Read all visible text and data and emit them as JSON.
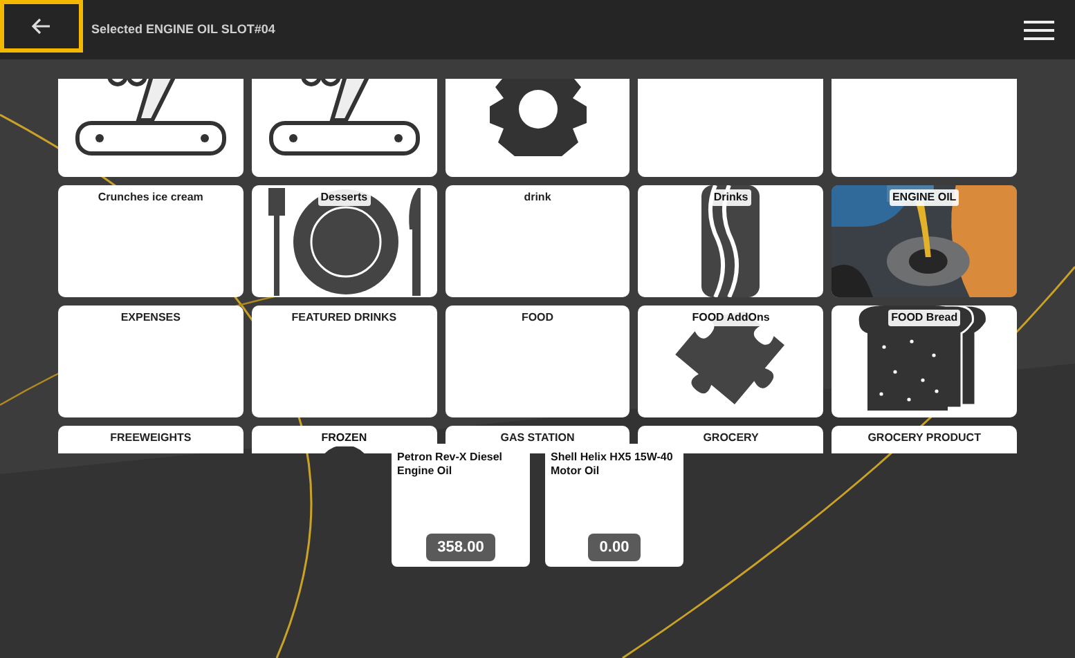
{
  "header": {
    "title": "Selected ENGINE OIL SLOT#04"
  },
  "categories": [
    {
      "kind": "tools"
    },
    {
      "kind": "tools"
    },
    {
      "kind": "gear"
    },
    {
      "kind": "plain"
    },
    {
      "kind": "plain"
    },
    {
      "label": "Crunches ice cream",
      "kind": "plain"
    },
    {
      "label": "Desserts",
      "kind": "plate"
    },
    {
      "label": "drink",
      "kind": "plain"
    },
    {
      "label": "Drinks",
      "kind": "bottle"
    },
    {
      "label": "ENGINE OIL",
      "kind": "picture"
    },
    {
      "label": "EXPENSES",
      "kind": "plain"
    },
    {
      "label": "FEATURED DRINKS",
      "kind": "plain"
    },
    {
      "label": "FOOD",
      "kind": "plain"
    },
    {
      "label": "FOOD AddOns",
      "kind": "puzzle"
    },
    {
      "label": "FOOD Bread",
      "kind": "bread"
    },
    {
      "label": "FREEWEIGHTS",
      "kind": "plain"
    },
    {
      "label": "FROZEN",
      "kind": "disc"
    },
    {
      "label": "GAS STATION",
      "kind": "plain"
    },
    {
      "label": "GROCERY",
      "kind": "plain"
    },
    {
      "label": "GROCERY PRODUCT",
      "kind": "plain"
    }
  ],
  "products": [
    {
      "name": "Petron Rev-X Diesel Engine Oil",
      "price": "358.00"
    },
    {
      "name": "Shell Helix HX5 15W-40 Motor Oil",
      "price": "0.00"
    }
  ]
}
